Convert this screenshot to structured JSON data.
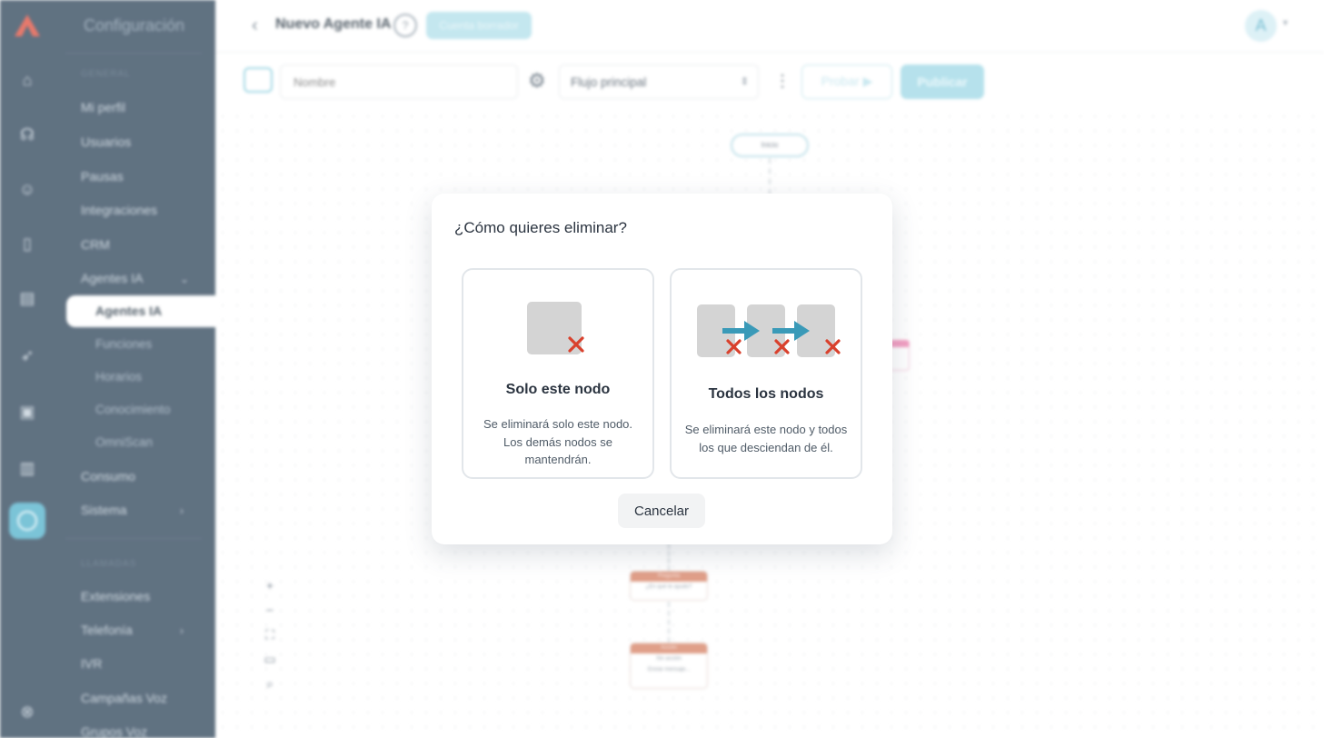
{
  "sidebar": {
    "title": "Configuración",
    "group_general": "GENERAL",
    "items": [
      {
        "label": "Mi perfil"
      },
      {
        "label": "Usuarios"
      },
      {
        "label": "Pausas"
      },
      {
        "label": "Integraciones"
      },
      {
        "label": "CRM"
      },
      {
        "label": "Agentes IA"
      }
    ],
    "sub_items": [
      {
        "label": "Agentes IA"
      },
      {
        "label": "Funciones"
      },
      {
        "label": "Horarios"
      },
      {
        "label": "Conocimiento"
      },
      {
        "label": "OmniScan"
      }
    ],
    "items2": [
      {
        "label": "Consumo"
      },
      {
        "label": "Sistema"
      }
    ],
    "group_calls": "LLAMADAS",
    "items3": [
      {
        "label": "Extensiones"
      },
      {
        "label": "Telefonía"
      },
      {
        "label": "IVR"
      },
      {
        "label": "Campañas Voz"
      },
      {
        "label": "Grupos Voz"
      }
    ]
  },
  "header": {
    "title": "Nuevo Agente IA",
    "help_glyph": "?",
    "status_badge": "Cuenta borrador",
    "avatar_initial": "A"
  },
  "toolbar": {
    "name_placeholder": "Nombre",
    "flow_select_value": "Flujo principal",
    "test_label": "Probar",
    "publish_label": "Publicar"
  },
  "canvas": {
    "start_node_label": "Inicio",
    "node1_head": "Pregunta",
    "node1_text": "¿En qué te ayudo?",
    "node2_head": "Acción",
    "node2_text1": "Sin acción",
    "node2_text2": "Enviar mensaje..."
  },
  "modal": {
    "title": "¿Cómo quieres eliminar?",
    "option_single": {
      "title": "Solo este nodo",
      "description": "Se eliminará solo este nodo. Los demás nodos se mantendrán."
    },
    "option_all": {
      "title": "Todos los nodos",
      "description": "Se eliminará este nodo y todos los que desciendan de él."
    },
    "cancel_label": "Cancelar"
  },
  "colors": {
    "sidebar_bg": "#3e5366",
    "accent": "#5fb7cf",
    "node_gray": "#d4d4d4",
    "arrow_blue": "#3a9ab8",
    "delete_red": "#d9412d"
  },
  "icons": [
    "back-arrow-icon",
    "help-icon",
    "gear-icon",
    "kebab-icon",
    "play-icon",
    "delete-x-icon",
    "arrow-right-icon"
  ]
}
